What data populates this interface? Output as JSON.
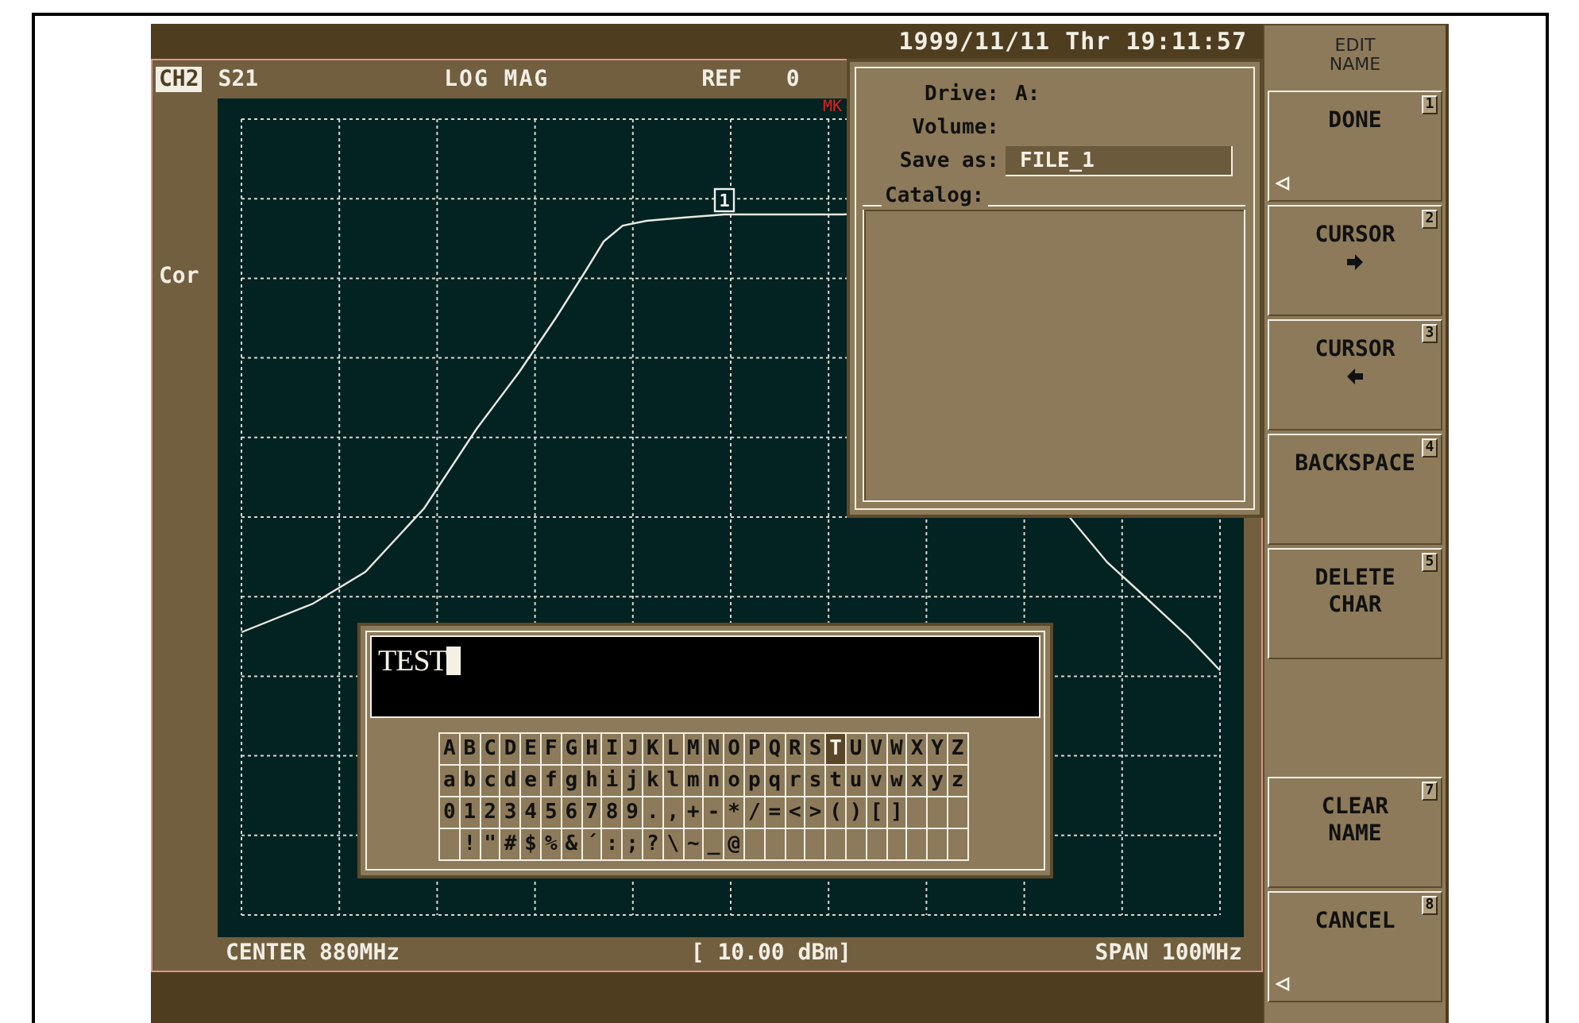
{
  "clock": "1999/11/11 Thr 19:11:57",
  "channel": {
    "label": "CH2",
    "parameter": "S21",
    "format": "LOG MAG",
    "ref_label": "REF",
    "ref_value": "0"
  },
  "side_label": "Cor",
  "graph": {
    "marker_label": "MK",
    "marker_number": "1"
  },
  "footer": {
    "center": "CENTER 880MHz",
    "power": "[ 10.00 dBm]",
    "span": "SPAN 100MHz"
  },
  "file_panel": {
    "drive_label": "Drive:",
    "drive": "A:",
    "volume_label": "Volume:",
    "save_label": "Save as:",
    "save_value": "FILE_1",
    "catalog_label": "Catalog:"
  },
  "name_editor": {
    "value": "TEST",
    "keys": [
      [
        {
          "label": "A",
          "selected": false
        },
        {
          "label": "B",
          "selected": false
        },
        {
          "label": "C",
          "selected": false
        },
        {
          "label": "D",
          "selected": false
        },
        {
          "label": "E",
          "selected": false
        },
        {
          "label": "F",
          "selected": false
        },
        {
          "label": "G",
          "selected": false
        },
        {
          "label": "H",
          "selected": false
        },
        {
          "label": "I",
          "selected": false
        },
        {
          "label": "J",
          "selected": false
        },
        {
          "label": "K",
          "selected": false
        },
        {
          "label": "L",
          "selected": false
        },
        {
          "label": "M",
          "selected": false
        },
        {
          "label": "N",
          "selected": false
        },
        {
          "label": "O",
          "selected": false
        },
        {
          "label": "P",
          "selected": false
        },
        {
          "label": "Q",
          "selected": false
        },
        {
          "label": "R",
          "selected": false
        },
        {
          "label": "S",
          "selected": false
        },
        {
          "label": "T",
          "selected": true
        },
        {
          "label": "U",
          "selected": false
        },
        {
          "label": "V",
          "selected": false
        },
        {
          "label": "W",
          "selected": false
        },
        {
          "label": "X",
          "selected": false
        },
        {
          "label": "Y",
          "selected": false
        },
        {
          "label": "Z",
          "selected": false
        }
      ],
      [
        {
          "label": "a",
          "selected": false
        },
        {
          "label": "b",
          "selected": false
        },
        {
          "label": "c",
          "selected": false
        },
        {
          "label": "d",
          "selected": false
        },
        {
          "label": "e",
          "selected": false
        },
        {
          "label": "f",
          "selected": false
        },
        {
          "label": "g",
          "selected": false
        },
        {
          "label": "h",
          "selected": false
        },
        {
          "label": "i",
          "selected": false
        },
        {
          "label": "j",
          "selected": false
        },
        {
          "label": "k",
          "selected": false
        },
        {
          "label": "l",
          "selected": false
        },
        {
          "label": "m",
          "selected": false
        },
        {
          "label": "n",
          "selected": false
        },
        {
          "label": "o",
          "selected": false
        },
        {
          "label": "p",
          "selected": false
        },
        {
          "label": "q",
          "selected": false
        },
        {
          "label": "r",
          "selected": false
        },
        {
          "label": "s",
          "selected": false
        },
        {
          "label": "t",
          "selected": false
        },
        {
          "label": "u",
          "selected": false
        },
        {
          "label": "v",
          "selected": false
        },
        {
          "label": "w",
          "selected": false
        },
        {
          "label": "x",
          "selected": false
        },
        {
          "label": "y",
          "selected": false
        },
        {
          "label": "z",
          "selected": false
        }
      ],
      [
        {
          "label": "0",
          "selected": false
        },
        {
          "label": "1",
          "selected": false
        },
        {
          "label": "2",
          "selected": false
        },
        {
          "label": "3",
          "selected": false
        },
        {
          "label": "4",
          "selected": false
        },
        {
          "label": "5",
          "selected": false
        },
        {
          "label": "6",
          "selected": false
        },
        {
          "label": "7",
          "selected": false
        },
        {
          "label": "8",
          "selected": false
        },
        {
          "label": "9",
          "selected": false
        },
        {
          "label": ".",
          "selected": false
        },
        {
          "label": ",",
          "selected": false
        },
        {
          "label": "+",
          "selected": false
        },
        {
          "label": "-",
          "selected": false
        },
        {
          "label": "*",
          "selected": false
        },
        {
          "label": "/",
          "selected": false
        },
        {
          "label": "=",
          "selected": false
        },
        {
          "label": "<",
          "selected": false
        },
        {
          "label": ">",
          "selected": false
        },
        {
          "label": "(",
          "selected": false
        },
        {
          "label": ")",
          "selected": false
        },
        {
          "label": "[",
          "selected": false
        },
        {
          "label": "]",
          "selected": false
        },
        {
          "selected": false
        },
        {
          "selected": false
        },
        {
          "selected": false
        }
      ],
      [
        {
          "selected": false
        },
        {
          "label": "!",
          "selected": false
        },
        {
          "label": "\"",
          "selected": false
        },
        {
          "label": "#",
          "selected": false
        },
        {
          "label": "$",
          "selected": false
        },
        {
          "label": "%",
          "selected": false
        },
        {
          "label": "&",
          "selected": false
        },
        {
          "label": "´",
          "selected": false
        },
        {
          "label": ":",
          "selected": false
        },
        {
          "label": ";",
          "selected": false
        },
        {
          "label": "?",
          "selected": false
        },
        {
          "label": "\\",
          "selected": false
        },
        {
          "label": "~",
          "selected": false
        },
        {
          "label": "_",
          "selected": false
        },
        {
          "label": "@",
          "selected": false
        },
        {
          "selected": false
        },
        {
          "selected": false
        },
        {
          "selected": false
        },
        {
          "selected": false
        },
        {
          "selected": false
        },
        {
          "selected": false
        },
        {
          "selected": false
        },
        {
          "selected": false
        },
        {
          "selected": false
        },
        {
          "selected": false
        },
        {
          "selected": false
        }
      ]
    ]
  },
  "softkeys": {
    "title_lines": [
      "EDIT",
      "NAME"
    ],
    "keys": [
      {
        "kind": "button",
        "lines": [
          "DONE"
        ],
        "number": "1",
        "pointer": true
      },
      {
        "kind": "rightarrow",
        "lines": [
          "CURSOR"
        ],
        "number": "2",
        "pointer": false
      },
      {
        "kind": "leftarrow",
        "lines": [
          "CURSOR"
        ],
        "number": "3",
        "pointer": false
      },
      {
        "kind": "button",
        "lines": [
          "BACKSPACE"
        ],
        "number": "4",
        "pointer": false
      },
      {
        "kind": "button",
        "lines": [
          "DELETE",
          "CHAR"
        ],
        "number": "5",
        "pointer": false
      },
      {
        "kind": "blank"
      },
      {
        "kind": "button",
        "lines": [
          "CLEAR",
          "NAME"
        ],
        "number": "7",
        "pointer": false
      },
      {
        "kind": "button",
        "lines": [
          "CANCEL"
        ],
        "number": "8",
        "pointer": true
      }
    ]
  }
}
